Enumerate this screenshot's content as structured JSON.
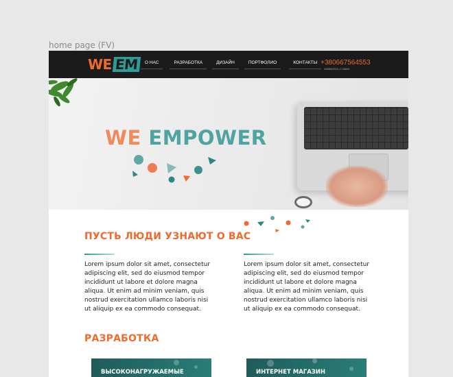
{
  "frame": {
    "label": "home page (FV)"
  },
  "header": {
    "logo": {
      "left": "WE",
      "right": "EM"
    },
    "nav": [
      "О НАС",
      "РАЗРАБОТКА",
      "ДИЗАЙН",
      "ПОРТФОЛИО",
      "КОНТАКТЫ"
    ],
    "phone": "+380667564553",
    "phone_sub": "свяжитесь с нами"
  },
  "hero": {
    "title_orange": "WE ",
    "title_teal": "EMPOWER"
  },
  "about": {
    "title": "ПУСТЬ ЛЮДИ УЗНАЮТ О ВАС",
    "col1": "Lorem ipsum dolor sit amet, consectetur adipiscing elit, sed do eiusmod tempor incididunt ut labore et dolore magna aliqua. Ut enim ad minim veniam, quis nostrud exercitation ullamco laboris nisi ut aliquip ex ea commodo consequat.",
    "col2": "Lorem ipsum dolor sit amet, consectetur adipiscing elit, sed do eiusmod tempor incididunt ut labore et dolore magna aliqua. Ut enim ad minim veniam, quis nostrud exercitation ullamco laboris nisi ut aliquip ex ea commodo consequat."
  },
  "development": {
    "title": "РАЗРАБОТКА",
    "cards": [
      "ВЫСОКОНАГРУЖАЕМЫЕ",
      "ИНТЕРНЕТ МАГАЗИН"
    ]
  },
  "colors": {
    "accent": "#ef6a2d",
    "teal": "#2e9c97",
    "header_bg": "#1b1b1b"
  }
}
